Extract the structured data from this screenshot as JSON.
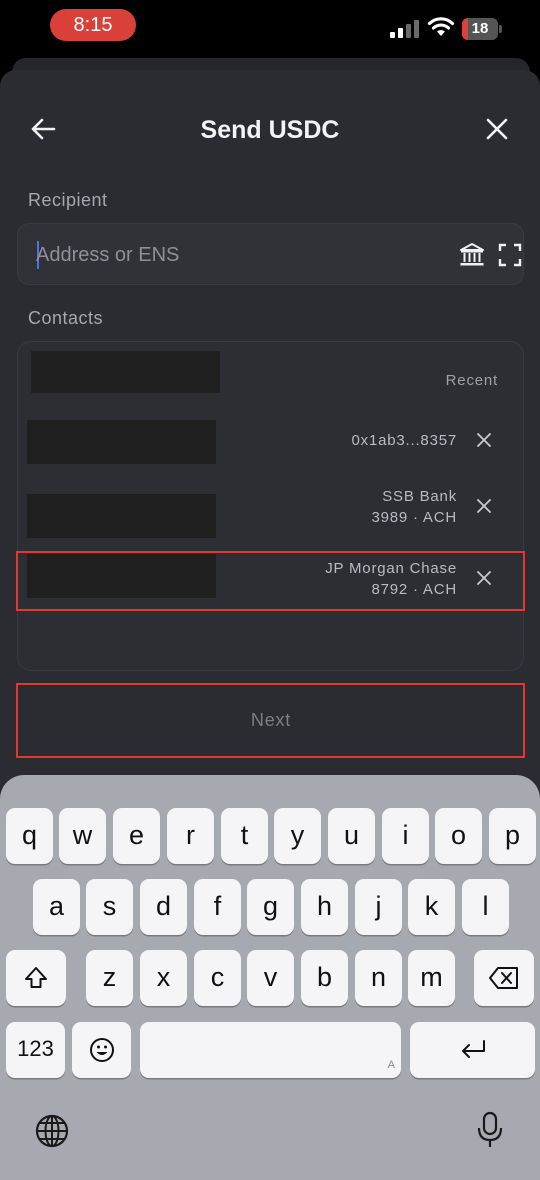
{
  "status_bar": {
    "time": "8:15",
    "battery": "18"
  },
  "header": {
    "title": "Send USDC"
  },
  "recipient": {
    "label": "Recipient",
    "placeholder": "Address or ENS"
  },
  "contacts": {
    "label": "Contacts",
    "recent_label": "Recent",
    "items": [
      {
        "line1": "0x1ab3...8357",
        "line2": ""
      },
      {
        "line1": "SSB Bank",
        "line2": "3989 · ACH"
      },
      {
        "line1": "JP Morgan Chase",
        "line2": "8792 · ACH"
      }
    ]
  },
  "next_button": {
    "label": "Next"
  },
  "keyboard": {
    "row1": [
      "q",
      "w",
      "e",
      "r",
      "t",
      "y",
      "u",
      "i",
      "o",
      "p"
    ],
    "row2": [
      "a",
      "s",
      "d",
      "f",
      "g",
      "h",
      "j",
      "k",
      "l"
    ],
    "row3": [
      "z",
      "x",
      "c",
      "v",
      "b",
      "n",
      "m"
    ],
    "numbers_key": "123",
    "space_hint": "A"
  },
  "colors": {
    "accent_highlight": "#e0392f",
    "sheet_bg": "#2a2c32",
    "caret": "#4e6fe8"
  }
}
